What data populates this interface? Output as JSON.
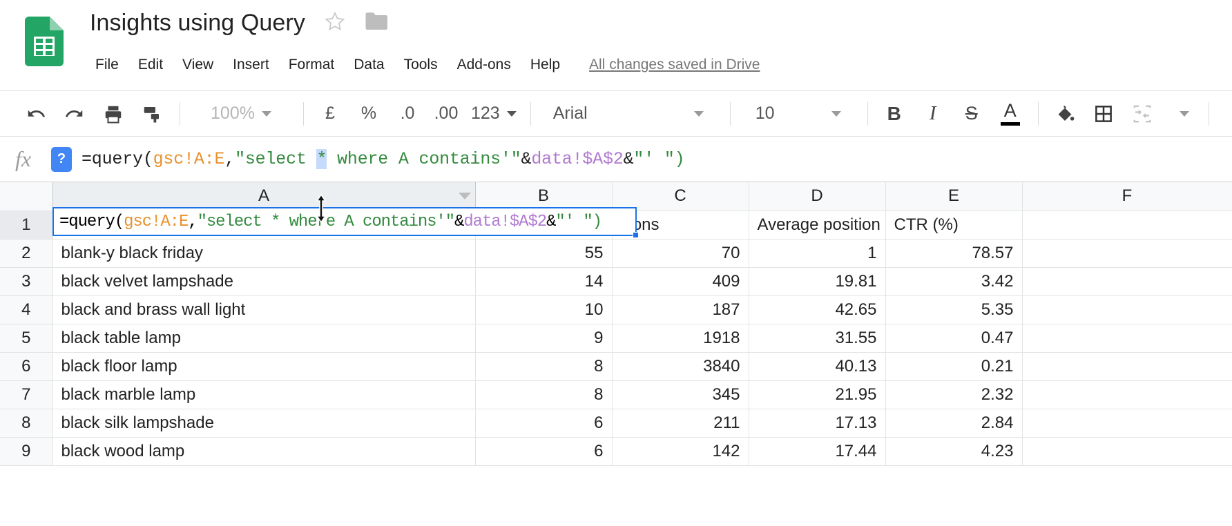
{
  "app": {
    "doc_title": "Insights using Query",
    "star_icon": "star-outline-icon",
    "folder_icon": "folder-icon",
    "logo_icon": "google-sheets-logo"
  },
  "menubar": {
    "items": [
      {
        "label": "File"
      },
      {
        "label": "Edit"
      },
      {
        "label": "View"
      },
      {
        "label": "Insert"
      },
      {
        "label": "Format"
      },
      {
        "label": "Data"
      },
      {
        "label": "Tools"
      },
      {
        "label": "Add-ons"
      },
      {
        "label": "Help"
      }
    ],
    "save_status": "All changes saved in Drive"
  },
  "toolbar": {
    "undo": "undo-icon",
    "redo": "redo-icon",
    "print": "print-icon",
    "paint_format": "paint-format-icon",
    "zoom_value": "100%",
    "currency": "£",
    "percent": "%",
    "decrease_decimal": ".0",
    "increase_decimal": ".00",
    "more_formats": "123",
    "font_family": "Arial",
    "font_size": "10",
    "bold": "B",
    "italic": "I",
    "strikethrough": "S",
    "text_color": "A",
    "fill_color": "fill-color-icon",
    "borders": "borders-icon",
    "merge_cells": "merge-cells-icon"
  },
  "formula_bar": {
    "fx_label": "fx",
    "help_badge": "?",
    "formula_parts": [
      {
        "text": "=query(",
        "type": "plain"
      },
      {
        "text": "gsc!A:E",
        "type": "ref"
      },
      {
        "text": ",",
        "type": "plain"
      },
      {
        "text": "\"select ",
        "type": "str"
      },
      {
        "text": "*",
        "type": "sel"
      },
      {
        "text": " where A contains'\"",
        "type": "str"
      },
      {
        "text": "&",
        "type": "plain"
      },
      {
        "text": "data!$A$2",
        "type": "sheet"
      },
      {
        "text": "&",
        "type": "plain"
      },
      {
        "text": "\"' \")",
        "type": "str"
      }
    ],
    "formula_plain": "=query(gsc!A:E,\"select * where A contains'\"&data!$A$2&\"' \")"
  },
  "grid": {
    "column_headers": [
      "A",
      "B",
      "C",
      "D",
      "E",
      "F"
    ],
    "row_numbers": [
      "1",
      "2",
      "3",
      "4",
      "5",
      "6",
      "7",
      "8",
      "9"
    ],
    "active_cell": "A1",
    "selected_cell_formula": "=query(gsc!A:E,\"select * where A contains'\"&data!$A$2&\"' \")",
    "header_row": {
      "A": "",
      "B": "",
      "C": "sions",
      "D": "Average position",
      "E": "CTR (%)",
      "F": ""
    },
    "rows": [
      {
        "n": "2",
        "A": "blank-y black friday",
        "B": "55",
        "C": "70",
        "D": "1",
        "E": "78.57",
        "F": ""
      },
      {
        "n": "3",
        "A": "black velvet lampshade",
        "B": "14",
        "C": "409",
        "D": "19.81",
        "E": "3.42",
        "F": ""
      },
      {
        "n": "4",
        "A": "black and brass wall light",
        "B": "10",
        "C": "187",
        "D": "42.65",
        "E": "5.35",
        "F": ""
      },
      {
        "n": "5",
        "A": "black table lamp",
        "B": "9",
        "C": "1918",
        "D": "31.55",
        "E": "0.47",
        "F": ""
      },
      {
        "n": "6",
        "A": "black floor lamp",
        "B": "8",
        "C": "3840",
        "D": "40.13",
        "E": "0.21",
        "F": ""
      },
      {
        "n": "7",
        "A": "black marble lamp",
        "B": "8",
        "C": "345",
        "D": "21.95",
        "E": "2.32",
        "F": ""
      },
      {
        "n": "8",
        "A": "black silk lampshade",
        "B": "6",
        "C": "211",
        "D": "17.13",
        "E": "2.84",
        "F": ""
      },
      {
        "n": "9",
        "A": "black wood lamp",
        "B": "6",
        "C": "142",
        "D": "17.44",
        "E": "4.23",
        "F": ""
      }
    ]
  },
  "colors": {
    "brand_green": "#23a566",
    "accent_blue": "#1a73e8",
    "selection_blue": "#c6dafc",
    "ref_orange": "#e8912d",
    "string_green": "#338a3e",
    "sheet_purple": "#b07ad1"
  }
}
